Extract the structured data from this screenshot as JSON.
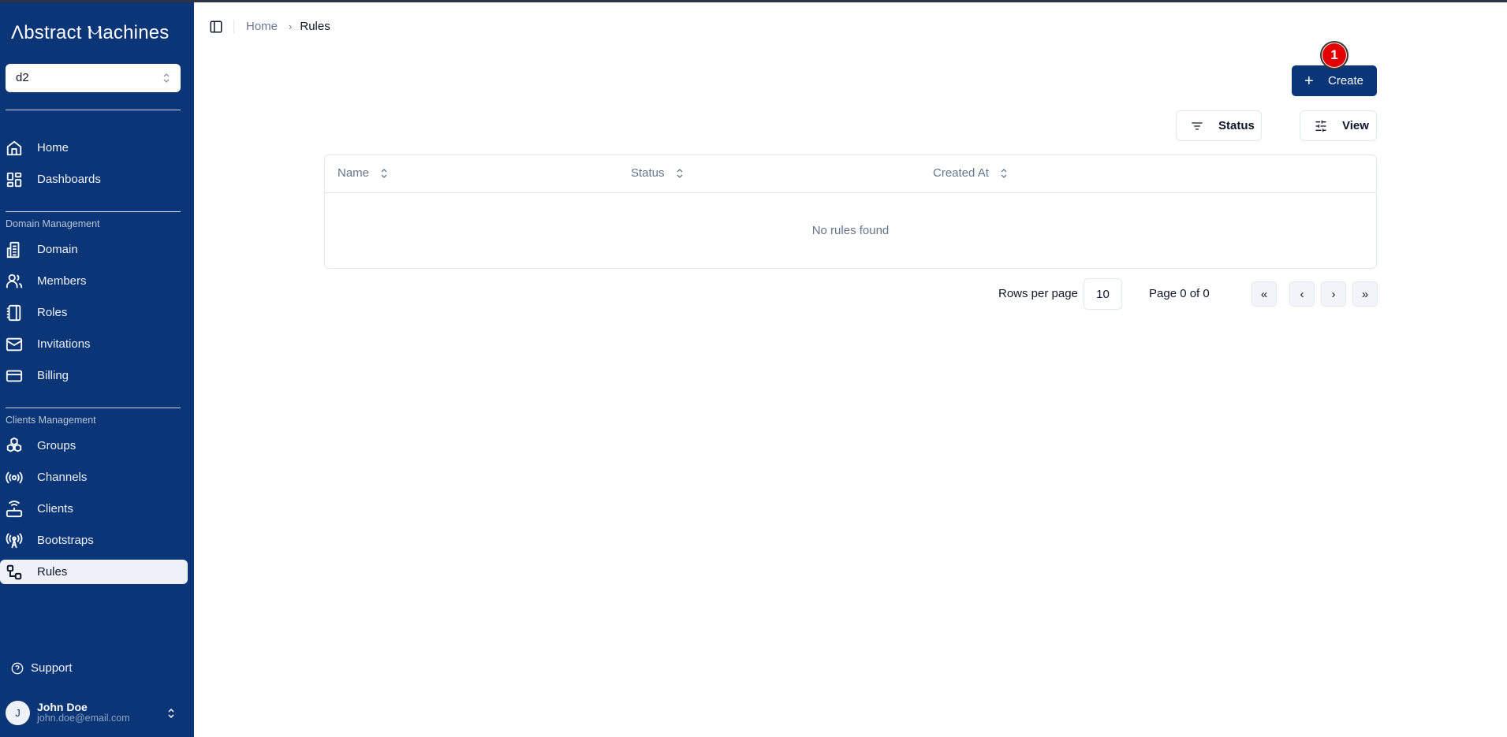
{
  "app": {
    "logo_text": "Λbstract Ⲙachines"
  },
  "domain_selector": {
    "value": "d2"
  },
  "sidebar": {
    "top_items": [
      {
        "label": "Home",
        "icon": "home-icon"
      },
      {
        "label": "Dashboards",
        "icon": "dashboard-grid-icon"
      }
    ],
    "sections": [
      {
        "title": "Domain Management",
        "items": [
          {
            "label": "Domain",
            "icon": "building-icon"
          },
          {
            "label": "Members",
            "icon": "users-icon"
          },
          {
            "label": "Roles",
            "icon": "notebook-icon"
          },
          {
            "label": "Invitations",
            "icon": "mail-icon"
          },
          {
            "label": "Billing",
            "icon": "credit-card-icon"
          }
        ]
      },
      {
        "title": "Clients Management",
        "items": [
          {
            "label": "Groups",
            "icon": "boxes-icon"
          },
          {
            "label": "Channels",
            "icon": "radio-icon"
          },
          {
            "label": "Clients",
            "icon": "router-icon"
          },
          {
            "label": "Bootstraps",
            "icon": "antenna-icon"
          },
          {
            "label": "Rules",
            "icon": "workflow-icon",
            "active": true
          }
        ]
      }
    ],
    "support_label": "Support",
    "user": {
      "initial": "J",
      "name": "John Doe",
      "email": "john.doe@email.com"
    }
  },
  "breadcrumb": {
    "home": "Home",
    "current": "Rules"
  },
  "toolbar": {
    "create_label": "Create",
    "badge_count": "1",
    "status_filter_label": "Status",
    "view_label": "View"
  },
  "table": {
    "columns": [
      "Name",
      "Status",
      "Created At"
    ],
    "empty_message": "No rules found"
  },
  "pagination": {
    "rows_per_page_label": "Rows per page",
    "rows_per_page": "10",
    "page_info": "Page 0 of 0",
    "first": "«",
    "prev": "‹",
    "next": "›",
    "last": "»"
  }
}
